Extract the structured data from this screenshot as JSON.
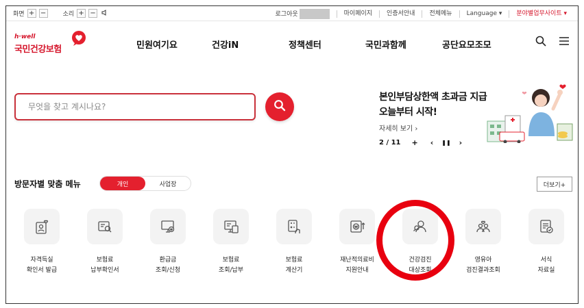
{
  "utility": {
    "screen_label": "화면",
    "sound_label": "소리",
    "plus": "+",
    "minus": "−",
    "logout": "로그아웃",
    "mypage": "마이페이지",
    "certificate": "인증서안내",
    "all_menu": "전체메뉴",
    "language": "Language ▾",
    "sector_site": "분야별업무사이트 ▾"
  },
  "logo": {
    "hwell": "h·well",
    "name": "국민건강보험"
  },
  "menu": [
    "민원여기요",
    "건강iN",
    "정책센터",
    "국민과함께",
    "공단요모조모"
  ],
  "search": {
    "placeholder": "무엇을 찾고 계시나요?"
  },
  "banner": {
    "line1": "본인부담상한액 초과금 지급",
    "line2": "오늘부터 시작!",
    "more": "자세히 보기 ›",
    "page": "2 / 11",
    "plus": "+",
    "prev": "‹",
    "pause": "❚❚",
    "next": "›"
  },
  "visitor": {
    "title": "방문자별 맞춤 메뉴",
    "tab_personal": "개인",
    "tab_business": "사업장",
    "more": "더보기+"
  },
  "services": [
    {
      "l1": "자격득실",
      "l2": "확인서 발급"
    },
    {
      "l1": "보험료",
      "l2": "납부확인서"
    },
    {
      "l1": "환급금",
      "l2": "조회/신청"
    },
    {
      "l1": "보험료",
      "l2": "조회/납부"
    },
    {
      "l1": "보험료",
      "l2": "계산기"
    },
    {
      "l1": "재난적의료비",
      "l2": "지원안내"
    },
    {
      "l1": "건강검진",
      "l2": "대상조회"
    },
    {
      "l1": "영유아",
      "l2": "검진결과조회"
    },
    {
      "l1": "서식",
      "l2": "자료실"
    }
  ],
  "colors": {
    "brand_red": "#e4202e",
    "highlight": "#e8000f"
  }
}
